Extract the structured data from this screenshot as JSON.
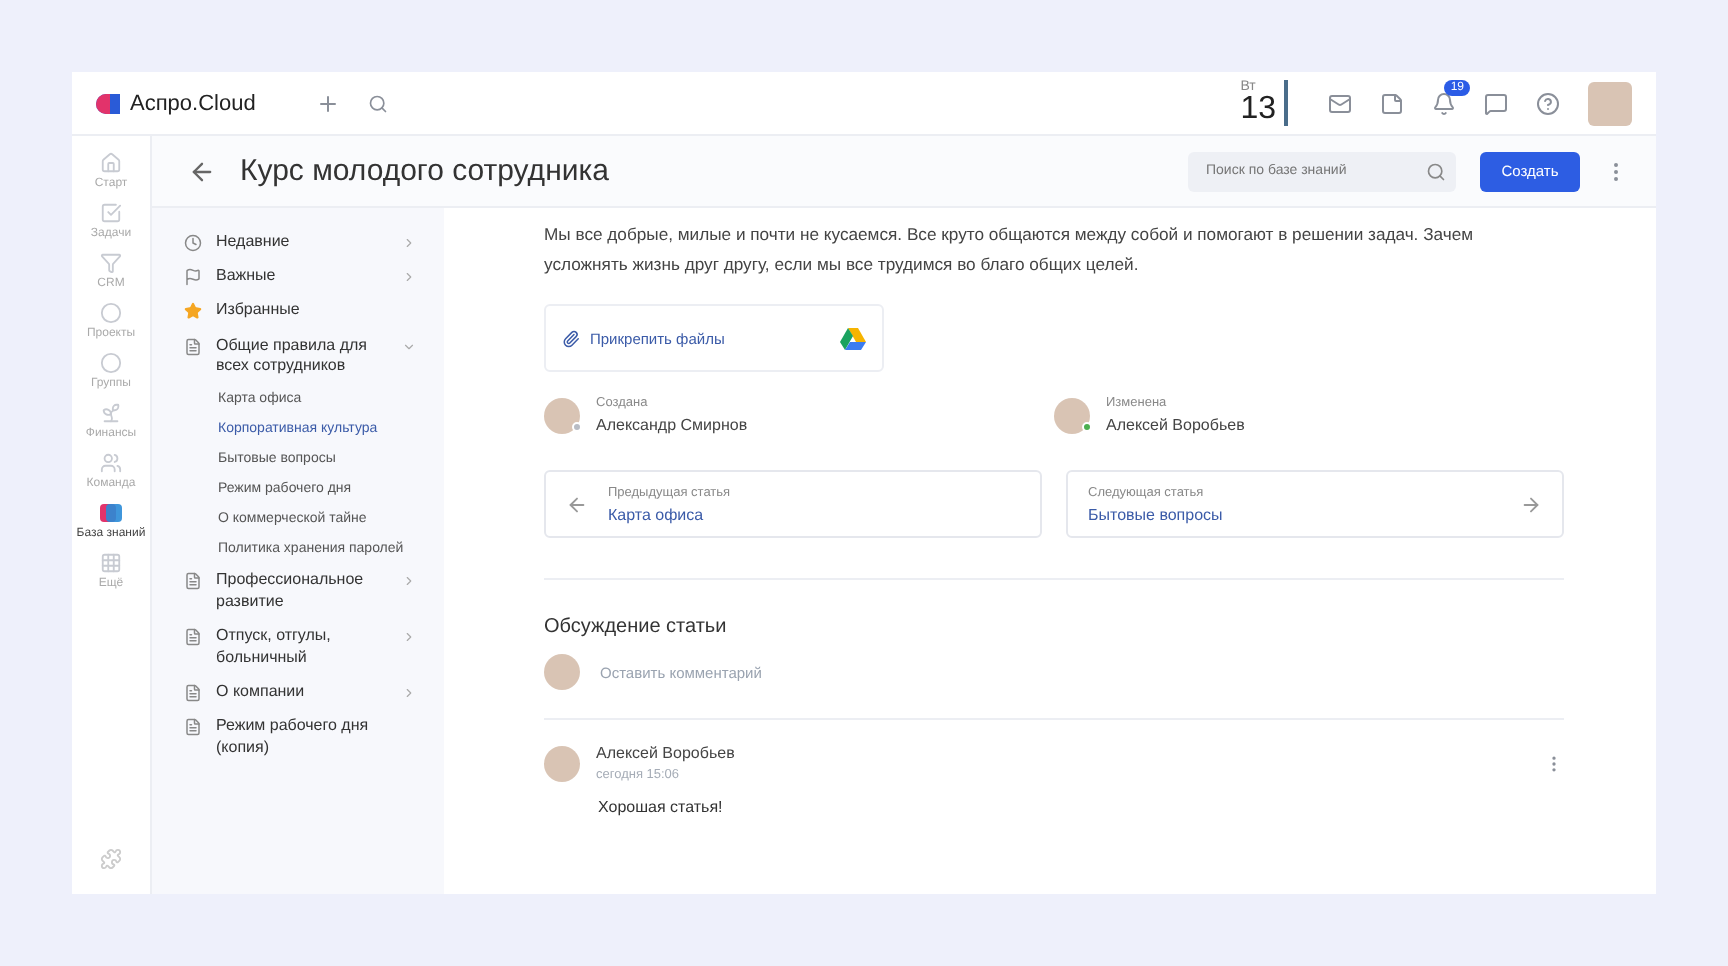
{
  "topbar": {
    "logo": "Аспро.Cloud",
    "day_name": "Вт",
    "day": "13",
    "notifications": "19"
  },
  "rail": [
    {
      "label": "Старт",
      "selected": false
    },
    {
      "label": "Задачи",
      "selected": false
    },
    {
      "label": "CRM",
      "selected": false
    },
    {
      "label": "Проекты",
      "selected": false
    },
    {
      "label": "Группы",
      "selected": false
    },
    {
      "label": "Финансы",
      "selected": false
    },
    {
      "label": "Команда",
      "selected": false
    },
    {
      "label": "База знаний",
      "selected": true
    },
    {
      "label": "Ещё",
      "selected": false
    }
  ],
  "header": {
    "title": "Курс молодого сотрудника",
    "search_placeholder": "Поиск по базе знаний",
    "create_button": "Создать"
  },
  "tree": [
    {
      "kind": "recent",
      "label": "Недавние",
      "has_arrow": true,
      "expanded": false
    },
    {
      "kind": "flag",
      "label": "Важные",
      "has_arrow": true,
      "expanded": false
    },
    {
      "kind": "star",
      "label": "Избранные",
      "has_arrow": false
    },
    {
      "kind": "doc",
      "label": "Общие правила для всех сотрудников",
      "has_arrow": true,
      "expanded": true,
      "children": [
        {
          "label": "Карта офиса",
          "selected": false
        },
        {
          "label": "Корпоративная культура",
          "selected": true
        },
        {
          "label": "Бытовые вопросы",
          "selected": false
        },
        {
          "label": "Режим рабочего дня",
          "selected": false
        },
        {
          "label": "О коммерческой тайне",
          "selected": false
        },
        {
          "label": "Политика хранения паролей",
          "selected": false
        }
      ]
    },
    {
      "kind": "doc",
      "label": "Профессиональное развитие",
      "has_arrow": true,
      "expanded": false
    },
    {
      "kind": "doc",
      "label": "Отпуск, отгулы, больничный",
      "has_arrow": true,
      "expanded": false
    },
    {
      "kind": "doc",
      "label": "О компании",
      "has_arrow": true,
      "expanded": false
    },
    {
      "kind": "doc",
      "label": "Режим рабочего дня (копия)",
      "has_arrow": false
    }
  ],
  "article": {
    "text": "Мы все добрые, милые и почти не кусаемся. Все круто общаются между собой и помогают в решении задач. Зачем усложнять жизнь друг другу, если мы все трудимся во благо общих целей.",
    "attach": "Прикрепить файлы",
    "authors": [
      {
        "caption": "Создана",
        "name": "Александр Смирнов",
        "online": false
      },
      {
        "caption": "Изменена",
        "name": "Алексей Воробьев",
        "online": true
      }
    ],
    "nav": [
      {
        "kind": "prev",
        "caption": "Предыдущая статья",
        "title": "Карта офиса"
      },
      {
        "kind": "next",
        "caption": "Следующая статья",
        "title": "Бытовые вопросы"
      }
    ]
  },
  "discussion": {
    "title": "Обсуждение статьи",
    "placeholder": "Оставить комментарий",
    "comments": [
      {
        "author": "Алексей Воробьев",
        "time": "сегодня 15:06",
        "text": "Хорошая статья!"
      }
    ]
  }
}
